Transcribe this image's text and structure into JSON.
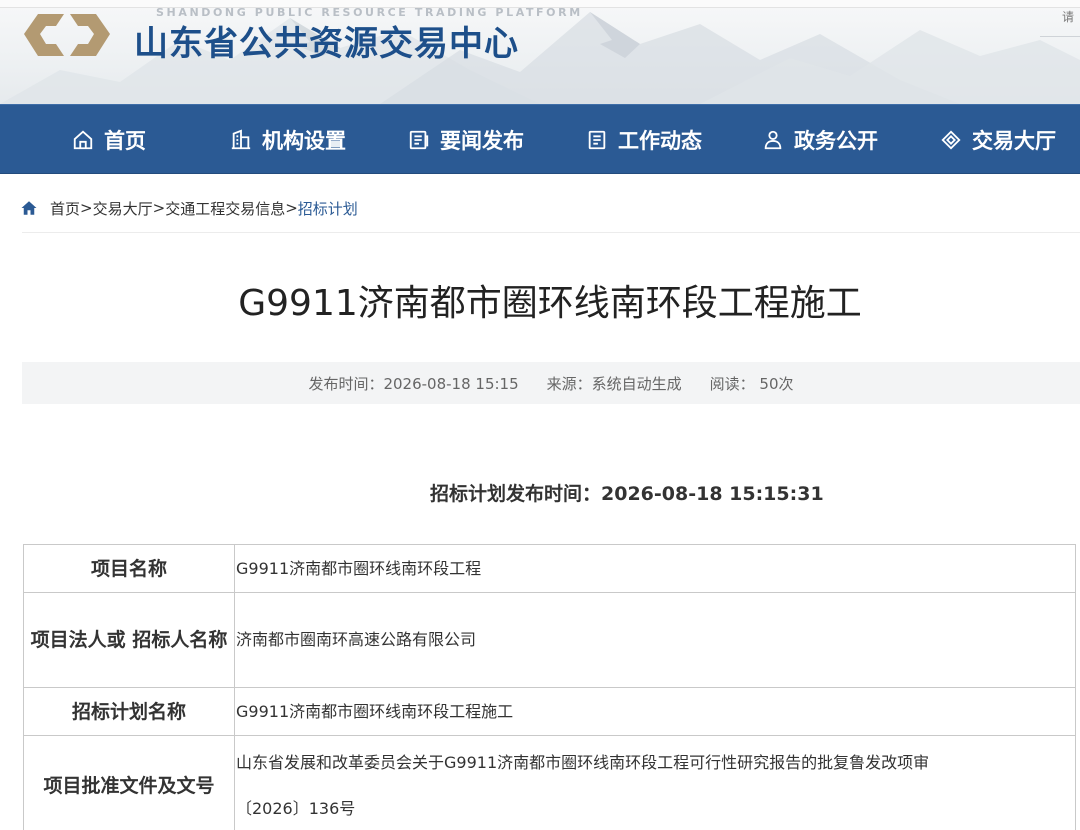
{
  "header": {
    "site_name_en": "SHANDONG PUBLIC RESOURCE TRADING PLATFORM",
    "site_name_cn": "山东省公共资源交易中心",
    "corner_text": "请"
  },
  "nav": {
    "items": [
      {
        "label": "首页",
        "icon": "home-icon"
      },
      {
        "label": "机构设置",
        "icon": "building-icon"
      },
      {
        "label": "要闻发布",
        "icon": "document-icon"
      },
      {
        "label": "工作动态",
        "icon": "list-icon"
      },
      {
        "label": "政务公开",
        "icon": "person-icon"
      },
      {
        "label": "交易大厅",
        "icon": "diamond-icon"
      }
    ]
  },
  "breadcrumb": {
    "items": [
      "首页",
      "交易大厅",
      "交通工程交易信息"
    ],
    "separator": ">",
    "current": "招标计划"
  },
  "article": {
    "title": "G9911济南都市圈环线南环段工程施工",
    "meta": {
      "publish_time": "发布时间：2026-08-18 15:15",
      "source": "来源：系统自动生成",
      "views": "阅读： 50次"
    },
    "plan_publish_time": "招标计划发布时间：2026-08-18 15:15:31"
  },
  "table": {
    "rows": [
      {
        "label_lines": [
          "项目名称"
        ],
        "value_lines": [
          "G9911济南都市圈环线南环段工程"
        ]
      },
      {
        "label_lines": [
          "项目法人或",
          "招标人名称"
        ],
        "value_lines": [
          "济南都市圈南环高速公路有限公司"
        ]
      },
      {
        "label_lines": [
          "招标计划名称"
        ],
        "value_lines": [
          "G9911济南都市圈环线南环段工程施工"
        ]
      },
      {
        "label_lines": [
          "项目批准文件及文号"
        ],
        "value_lines": [
          "山东省发展和改革委员会关于G9911济南都市圈环线南环段工程可行性研究报告的批复鲁发改项审",
          "〔2026〕136号"
        ]
      }
    ]
  },
  "colors": {
    "nav_bg": "#2b5a94",
    "brand_text": "#1d4f8a",
    "breadcrumb_current": "#2b5a94"
  }
}
